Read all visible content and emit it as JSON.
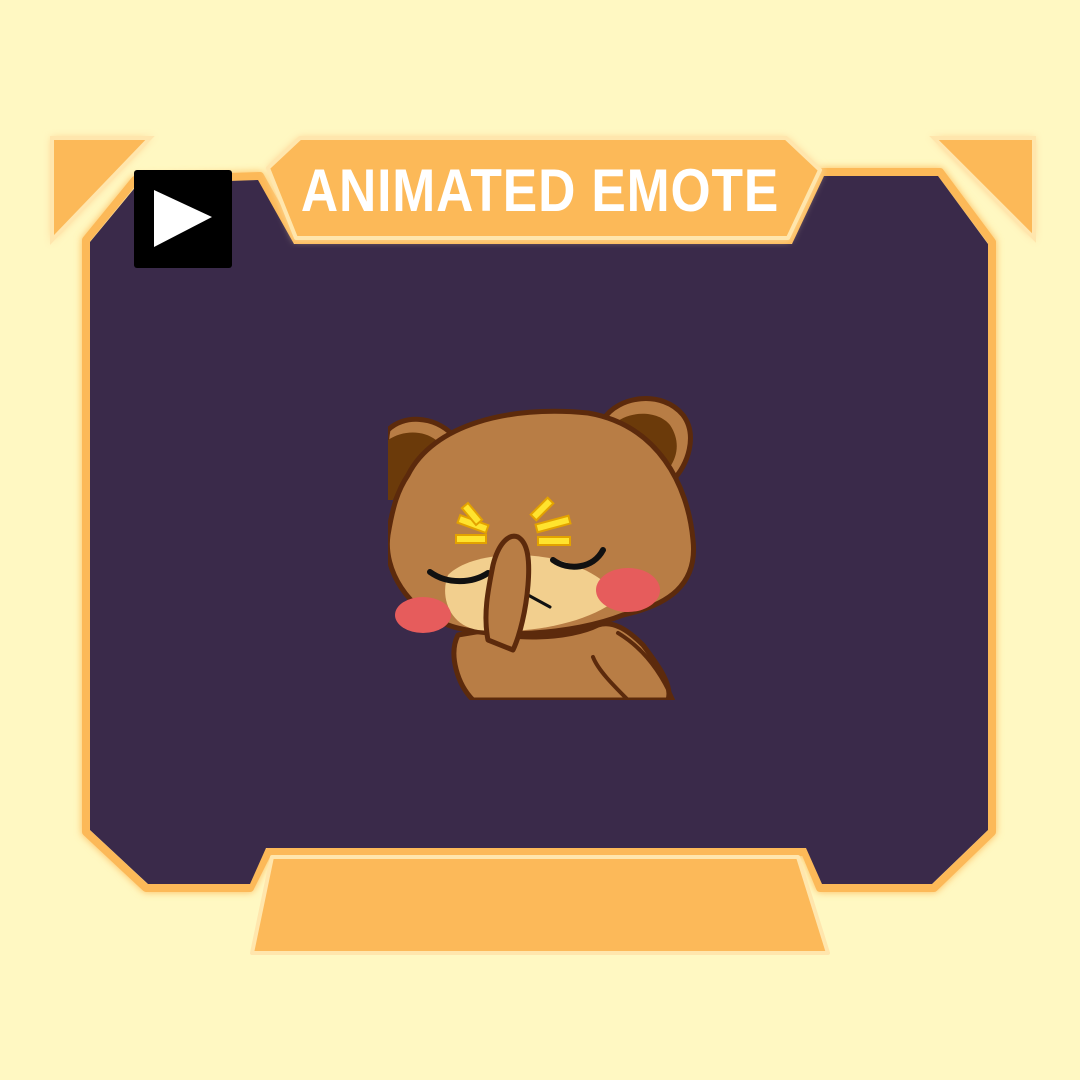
{
  "banner": {
    "title": "ANIMATED EMOTE"
  },
  "controls": {
    "play_icon": "play-icon"
  },
  "emote": {
    "character": "bear-facepalm-emote",
    "icon": "bear-icon"
  },
  "colors": {
    "background": "#fff8c2",
    "panel": "#3a2a4a",
    "accent": "#fcb959",
    "accent_glow": "#ffe6ad",
    "title_text": "#ffffff",
    "bear_fur": "#b87d45",
    "bear_outline": "#5c2a0c",
    "bear_muzzle": "#f2cf8e",
    "blush": "#e65c5c",
    "sparkle": "#ffe32e"
  },
  "footer": {
    "label": ""
  }
}
